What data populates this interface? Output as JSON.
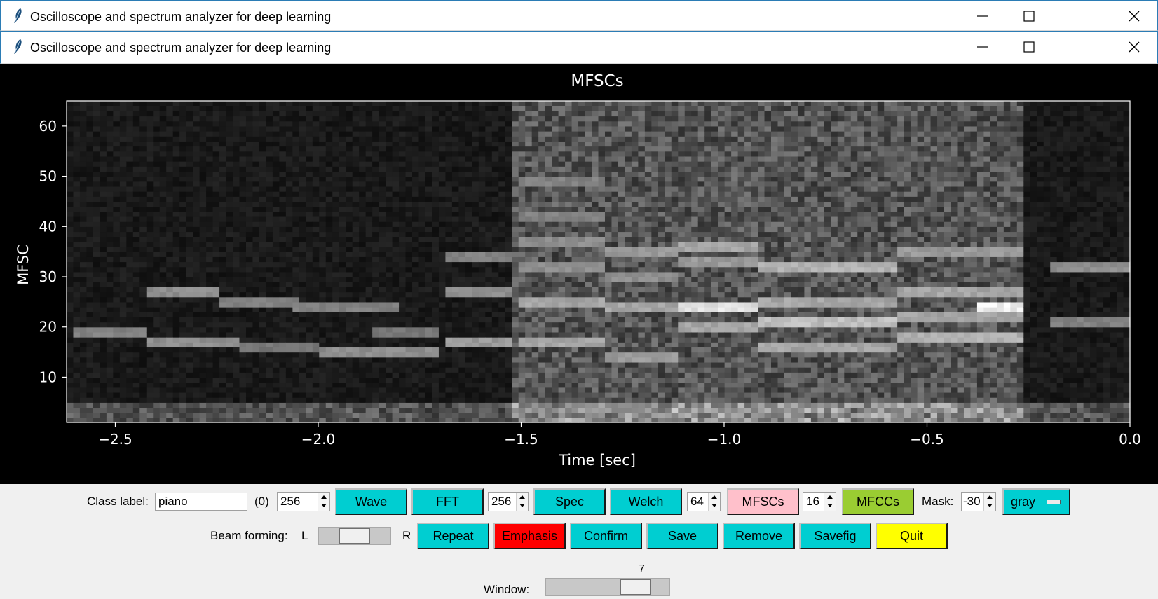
{
  "windows": [
    {
      "title": "Oscilloscope and spectrum analyzer for deep learning"
    },
    {
      "title": "Oscilloscope and spectrum analyzer for deep learning"
    }
  ],
  "plot": {
    "title": "MFSCs",
    "xlabel": "Time [sec]",
    "ylabel": "MFSC",
    "xticks": [
      "−2.5",
      "−2.0",
      "−1.5",
      "−1.0",
      "−0.5",
      "0.0"
    ],
    "yticks": [
      "10",
      "20",
      "30",
      "40",
      "50",
      "60"
    ]
  },
  "chart_data": {
    "type": "heatmap",
    "title": "MFSCs",
    "xlabel": "Time [sec]",
    "ylabel": "MFSC",
    "xlim": [
      -2.62,
      0.0
    ],
    "ylim": [
      1,
      65
    ],
    "colormap": "gray",
    "x_ticks": [
      -2.5,
      -2.0,
      -1.5,
      -1.0,
      -0.5,
      0.0
    ],
    "y_ticks": [
      10,
      20,
      30,
      40,
      50,
      60
    ],
    "segments": [
      {
        "t_start": -2.62,
        "t_end": -1.52,
        "brightness": "low"
      },
      {
        "t_start": -1.52,
        "t_end": -0.26,
        "brightness": "high"
      },
      {
        "t_start": -0.26,
        "t_end": 0.0,
        "brightness": "low"
      }
    ],
    "harmonic_bands": [
      {
        "t_start": -2.6,
        "t_end": -2.42,
        "mfsc": 19,
        "level": 0.55
      },
      {
        "t_start": -2.42,
        "t_end": -2.25,
        "mfsc": 27,
        "level": 0.6
      },
      {
        "t_start": -2.42,
        "t_end": -2.2,
        "mfsc": 17,
        "level": 0.6
      },
      {
        "t_start": -2.25,
        "t_end": -2.05,
        "mfsc": 25,
        "level": 0.55
      },
      {
        "t_start": -2.2,
        "t_end": -2.0,
        "mfsc": 16,
        "level": 0.5
      },
      {
        "t_start": -2.06,
        "t_end": -1.8,
        "mfsc": 24,
        "level": 0.55
      },
      {
        "t_start": -2.0,
        "t_end": -1.7,
        "mfsc": 15,
        "level": 0.6
      },
      {
        "t_start": -1.86,
        "t_end": -1.7,
        "mfsc": 19,
        "level": 0.5
      },
      {
        "t_start": -1.68,
        "t_end": -1.52,
        "mfsc": 34,
        "level": 0.55
      },
      {
        "t_start": -1.68,
        "t_end": -1.52,
        "mfsc": 27,
        "level": 0.6
      },
      {
        "t_start": -1.68,
        "t_end": -1.52,
        "mfsc": 17,
        "level": 0.65
      },
      {
        "t_start": -1.5,
        "t_end": -1.3,
        "mfsc": 49,
        "level": 0.55
      },
      {
        "t_start": -1.5,
        "t_end": -1.3,
        "mfsc": 42,
        "level": 0.55
      },
      {
        "t_start": -1.5,
        "t_end": -1.3,
        "mfsc": 37,
        "level": 0.6
      },
      {
        "t_start": -1.5,
        "t_end": -1.3,
        "mfsc": 32,
        "level": 0.6
      },
      {
        "t_start": -1.5,
        "t_end": -1.3,
        "mfsc": 25,
        "level": 0.7
      },
      {
        "t_start": -1.5,
        "t_end": -1.3,
        "mfsc": 17,
        "level": 0.7
      },
      {
        "t_start": -1.3,
        "t_end": -1.12,
        "mfsc": 35,
        "level": 0.65
      },
      {
        "t_start": -1.3,
        "t_end": -1.12,
        "mfsc": 30,
        "level": 0.6
      },
      {
        "t_start": -1.3,
        "t_end": -1.12,
        "mfsc": 24,
        "level": 0.7
      },
      {
        "t_start": -1.3,
        "t_end": -1.12,
        "mfsc": 14,
        "level": 0.65
      },
      {
        "t_start": -1.12,
        "t_end": -0.92,
        "mfsc": 36,
        "level": 0.7
      },
      {
        "t_start": -1.12,
        "t_end": -0.92,
        "mfsc": 33,
        "level": 0.65
      },
      {
        "t_start": -1.12,
        "t_end": -0.92,
        "mfsc": 24,
        "level": 0.95
      },
      {
        "t_start": -1.12,
        "t_end": -0.92,
        "mfsc": 20,
        "level": 0.7
      },
      {
        "t_start": -0.92,
        "t_end": -0.58,
        "mfsc": 32,
        "level": 0.75
      },
      {
        "t_start": -0.92,
        "t_end": -0.58,
        "mfsc": 25,
        "level": 0.7
      },
      {
        "t_start": -0.92,
        "t_end": -0.58,
        "mfsc": 21,
        "level": 0.8
      },
      {
        "t_start": -0.92,
        "t_end": -0.58,
        "mfsc": 16,
        "level": 0.7
      },
      {
        "t_start": -0.58,
        "t_end": -0.26,
        "mfsc": 35,
        "level": 0.65
      },
      {
        "t_start": -0.58,
        "t_end": -0.26,
        "mfsc": 27,
        "level": 0.7
      },
      {
        "t_start": -0.58,
        "t_end": -0.26,
        "mfsc": 22,
        "level": 0.7
      },
      {
        "t_start": -0.58,
        "t_end": -0.26,
        "mfsc": 18,
        "level": 0.75
      },
      {
        "t_start": -0.38,
        "t_end": -0.26,
        "mfsc": 24,
        "level": 1.0
      },
      {
        "t_start": -0.2,
        "t_end": 0.0,
        "mfsc": 32,
        "level": 0.6
      },
      {
        "t_start": -0.2,
        "t_end": 0.0,
        "mfsc": 21,
        "level": 0.55
      }
    ]
  },
  "controls": {
    "class_label": "Class label:",
    "class_value": "piano",
    "class_index": "(0)",
    "spin1": "256",
    "wave": "Wave",
    "fft": "FFT",
    "spin2": "256",
    "spec": "Spec",
    "welch": "Welch",
    "spin3": "64",
    "mfscs": "MFSCs",
    "spin4": "16",
    "mfccs": "MFCCs",
    "mask_label": "Mask:",
    "mask_value": "-30",
    "colormap": "gray",
    "beam_label": "Beam forming:",
    "beam_l": "L",
    "beam_r": "R",
    "beam_position": 0.5,
    "repeat": "Repeat",
    "emphasis": "Emphasis",
    "confirm": "Confirm",
    "save": "Save",
    "remove": "Remove",
    "savefig": "Savefig",
    "quit": "Quit",
    "window_label": "Window:",
    "window_value": "7",
    "window_position": 0.8
  },
  "colors": {
    "cyan": "#00ced1",
    "pink": "#ffc0cb",
    "green": "#9acd32",
    "red": "#ff0000",
    "yellow": "#ffff00"
  }
}
